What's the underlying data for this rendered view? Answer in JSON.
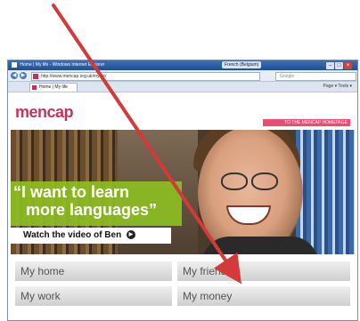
{
  "browser": {
    "window_title": "Home | My life - Windows Internet Explorer",
    "security_tab": "French (Belgium)",
    "url": "http://www.mencap.org.uk/mylife/",
    "search_placeholder": "Google",
    "tab_title": "Home | My life",
    "tools_label": "Page ▾  Tools ▾"
  },
  "site": {
    "logo_text": "mencap",
    "homepage_link": "TO THE MENCAP HOMEPAGE",
    "hero": {
      "quote_line1": "“I want to learn",
      "quote_line2": "more languages”",
      "video_label": "Watch the video of Ben"
    },
    "menu": {
      "home": "My home",
      "friends": "My friends",
      "work": "My work",
      "money": "My money"
    }
  },
  "colors": {
    "brand": "#c8325f",
    "accent_green": "#8cbe23",
    "arrow": "#d33a3a"
  }
}
